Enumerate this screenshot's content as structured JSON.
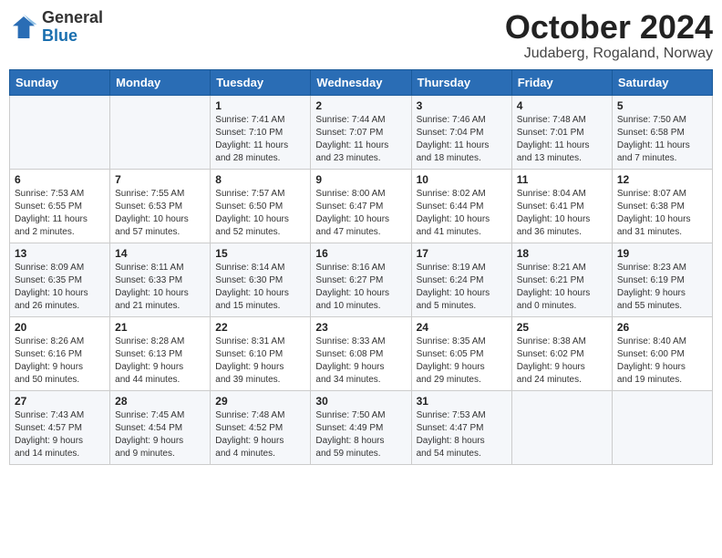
{
  "header": {
    "logo": {
      "general": "General",
      "blue": "Blue"
    },
    "title": "October 2024",
    "location": "Judaberg, Rogaland, Norway"
  },
  "calendar": {
    "weekdays": [
      "Sunday",
      "Monday",
      "Tuesday",
      "Wednesday",
      "Thursday",
      "Friday",
      "Saturday"
    ],
    "weeks": [
      [
        {
          "day": "",
          "info": ""
        },
        {
          "day": "",
          "info": ""
        },
        {
          "day": "1",
          "info": "Sunrise: 7:41 AM\nSunset: 7:10 PM\nDaylight: 11 hours\nand 28 minutes."
        },
        {
          "day": "2",
          "info": "Sunrise: 7:44 AM\nSunset: 7:07 PM\nDaylight: 11 hours\nand 23 minutes."
        },
        {
          "day": "3",
          "info": "Sunrise: 7:46 AM\nSunset: 7:04 PM\nDaylight: 11 hours\nand 18 minutes."
        },
        {
          "day": "4",
          "info": "Sunrise: 7:48 AM\nSunset: 7:01 PM\nDaylight: 11 hours\nand 13 minutes."
        },
        {
          "day": "5",
          "info": "Sunrise: 7:50 AM\nSunset: 6:58 PM\nDaylight: 11 hours\nand 7 minutes."
        }
      ],
      [
        {
          "day": "6",
          "info": "Sunrise: 7:53 AM\nSunset: 6:55 PM\nDaylight: 11 hours\nand 2 minutes."
        },
        {
          "day": "7",
          "info": "Sunrise: 7:55 AM\nSunset: 6:53 PM\nDaylight: 10 hours\nand 57 minutes."
        },
        {
          "day": "8",
          "info": "Sunrise: 7:57 AM\nSunset: 6:50 PM\nDaylight: 10 hours\nand 52 minutes."
        },
        {
          "day": "9",
          "info": "Sunrise: 8:00 AM\nSunset: 6:47 PM\nDaylight: 10 hours\nand 47 minutes."
        },
        {
          "day": "10",
          "info": "Sunrise: 8:02 AM\nSunset: 6:44 PM\nDaylight: 10 hours\nand 41 minutes."
        },
        {
          "day": "11",
          "info": "Sunrise: 8:04 AM\nSunset: 6:41 PM\nDaylight: 10 hours\nand 36 minutes."
        },
        {
          "day": "12",
          "info": "Sunrise: 8:07 AM\nSunset: 6:38 PM\nDaylight: 10 hours\nand 31 minutes."
        }
      ],
      [
        {
          "day": "13",
          "info": "Sunrise: 8:09 AM\nSunset: 6:35 PM\nDaylight: 10 hours\nand 26 minutes."
        },
        {
          "day": "14",
          "info": "Sunrise: 8:11 AM\nSunset: 6:33 PM\nDaylight: 10 hours\nand 21 minutes."
        },
        {
          "day": "15",
          "info": "Sunrise: 8:14 AM\nSunset: 6:30 PM\nDaylight: 10 hours\nand 15 minutes."
        },
        {
          "day": "16",
          "info": "Sunrise: 8:16 AM\nSunset: 6:27 PM\nDaylight: 10 hours\nand 10 minutes."
        },
        {
          "day": "17",
          "info": "Sunrise: 8:19 AM\nSunset: 6:24 PM\nDaylight: 10 hours\nand 5 minutes."
        },
        {
          "day": "18",
          "info": "Sunrise: 8:21 AM\nSunset: 6:21 PM\nDaylight: 10 hours\nand 0 minutes."
        },
        {
          "day": "19",
          "info": "Sunrise: 8:23 AM\nSunset: 6:19 PM\nDaylight: 9 hours\nand 55 minutes."
        }
      ],
      [
        {
          "day": "20",
          "info": "Sunrise: 8:26 AM\nSunset: 6:16 PM\nDaylight: 9 hours\nand 50 minutes."
        },
        {
          "day": "21",
          "info": "Sunrise: 8:28 AM\nSunset: 6:13 PM\nDaylight: 9 hours\nand 44 minutes."
        },
        {
          "day": "22",
          "info": "Sunrise: 8:31 AM\nSunset: 6:10 PM\nDaylight: 9 hours\nand 39 minutes."
        },
        {
          "day": "23",
          "info": "Sunrise: 8:33 AM\nSunset: 6:08 PM\nDaylight: 9 hours\nand 34 minutes."
        },
        {
          "day": "24",
          "info": "Sunrise: 8:35 AM\nSunset: 6:05 PM\nDaylight: 9 hours\nand 29 minutes."
        },
        {
          "day": "25",
          "info": "Sunrise: 8:38 AM\nSunset: 6:02 PM\nDaylight: 9 hours\nand 24 minutes."
        },
        {
          "day": "26",
          "info": "Sunrise: 8:40 AM\nSunset: 6:00 PM\nDaylight: 9 hours\nand 19 minutes."
        }
      ],
      [
        {
          "day": "27",
          "info": "Sunrise: 7:43 AM\nSunset: 4:57 PM\nDaylight: 9 hours\nand 14 minutes."
        },
        {
          "day": "28",
          "info": "Sunrise: 7:45 AM\nSunset: 4:54 PM\nDaylight: 9 hours\nand 9 minutes."
        },
        {
          "day": "29",
          "info": "Sunrise: 7:48 AM\nSunset: 4:52 PM\nDaylight: 9 hours\nand 4 minutes."
        },
        {
          "day": "30",
          "info": "Sunrise: 7:50 AM\nSunset: 4:49 PM\nDaylight: 8 hours\nand 59 minutes."
        },
        {
          "day": "31",
          "info": "Sunrise: 7:53 AM\nSunset: 4:47 PM\nDaylight: 8 hours\nand 54 minutes."
        },
        {
          "day": "",
          "info": ""
        },
        {
          "day": "",
          "info": ""
        }
      ]
    ]
  }
}
